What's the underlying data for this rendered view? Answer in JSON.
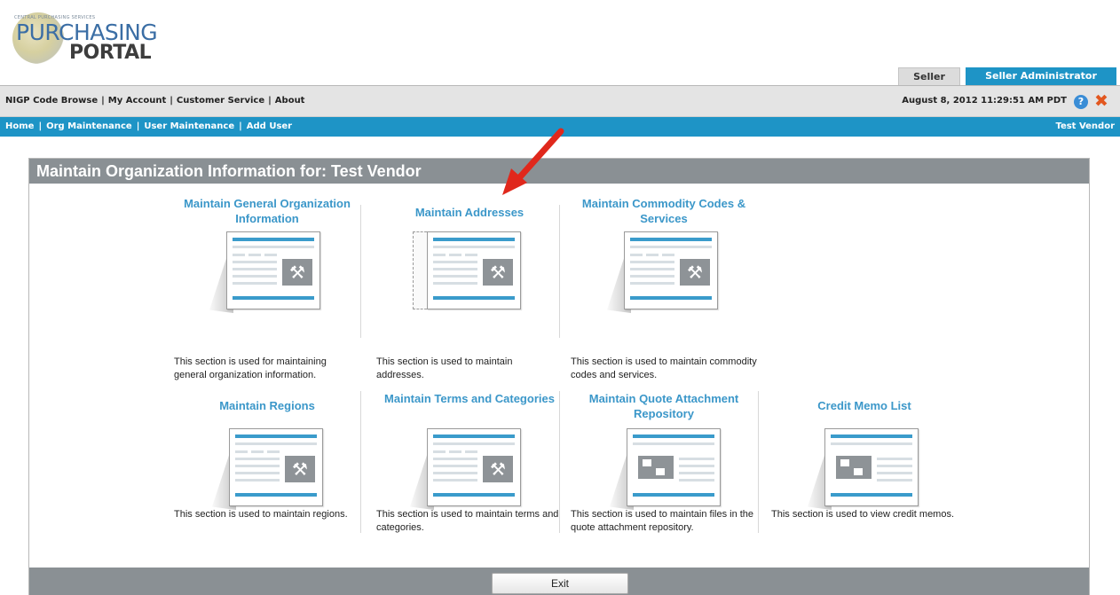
{
  "logo": {
    "tagline": "CENTRAL PURCHASING SERVICES",
    "line1": "PURCHASING",
    "line2": "PORTAL"
  },
  "role_tabs": {
    "seller": "Seller",
    "admin": "Seller Administrator"
  },
  "top_nav": {
    "links": [
      "NIGP Code Browse",
      "My Account",
      "Customer Service",
      "About"
    ],
    "datetime": "August 8, 2012 11:29:51 AM PDT"
  },
  "breadcrumb": {
    "links": [
      "Home",
      "Org Maintenance",
      "User Maintenance",
      "Add User"
    ],
    "vendor": "Test Vendor"
  },
  "panel": {
    "title": "Maintain Organization Information for: Test Vendor",
    "exit_label": "Exit"
  },
  "cards": [
    {
      "title": "Maintain General Organization Information",
      "desc": "This section is used for maintaining general organization information.",
      "icon": "tools-document-icon"
    },
    {
      "title": "Maintain Addresses",
      "desc": "This section is used to maintain addresses.",
      "icon": "tools-document-icon"
    },
    {
      "title": "Maintain Commodity Codes & Services",
      "desc": "This section is used to maintain commodity codes and services.",
      "icon": "tools-document-icon"
    },
    {
      "title": "Maintain Regions",
      "desc": "This section is used to maintain regions.",
      "icon": "tools-document-icon"
    },
    {
      "title": "Maintain Terms and Categories",
      "desc": "This section is used to maintain terms and categories.",
      "icon": "tools-document-icon"
    },
    {
      "title": "Maintain Quote Attachment Repository",
      "desc": "This section is used to maintain files in the quote attachment repository.",
      "icon": "files-document-icon"
    },
    {
      "title": "Credit Memo List",
      "desc": "This section is used to view credit memos.",
      "icon": "files-document-icon"
    }
  ],
  "colors": {
    "accent_blue": "#1e94c6",
    "link_blue": "#3b97c9",
    "panel_gray": "#8a9094",
    "arrow_red": "#e0281c"
  }
}
